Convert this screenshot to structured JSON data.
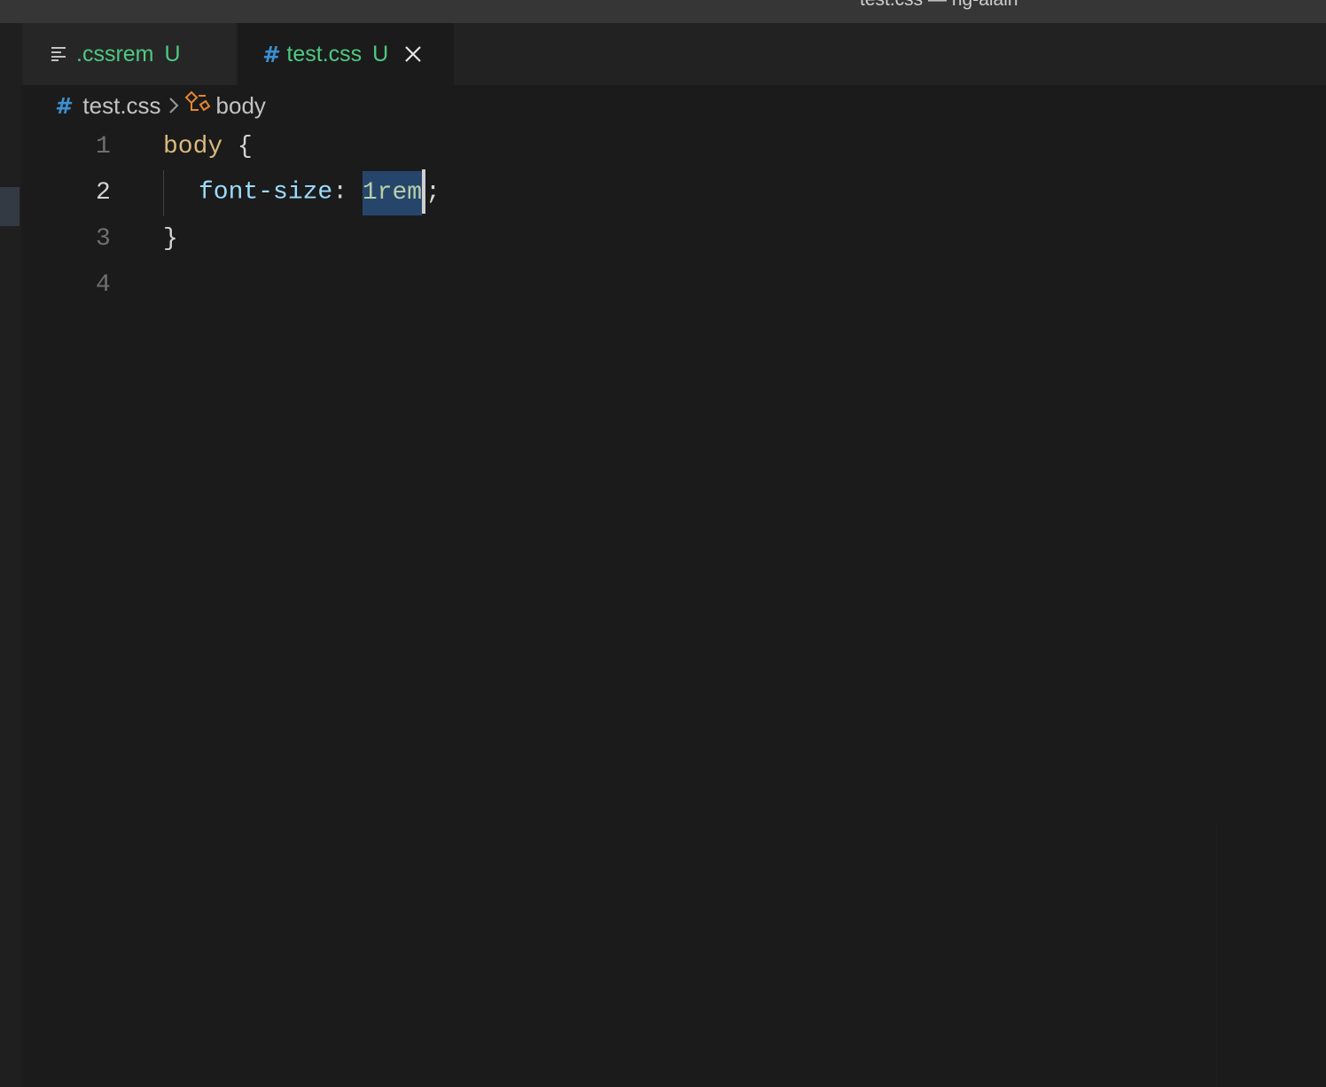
{
  "window": {
    "title": "test.css — ng-alain"
  },
  "tabs": [
    {
      "label": ".cssrem",
      "badge": "U",
      "icon": "list-icon",
      "active": false
    },
    {
      "label": "test.css",
      "badge": "U",
      "icon": "css-hash-icon",
      "active": true,
      "close_icon": "close-icon"
    }
  ],
  "breadcrumb": {
    "file": "test.css",
    "file_icon": "css-hash-icon",
    "separator_icon": "chevron-right-icon",
    "symbol": "body",
    "symbol_icon": "selector-symbol-icon"
  },
  "editor": {
    "line_numbers": [
      "1",
      "2",
      "3",
      "4"
    ],
    "active_line": "2",
    "line1": {
      "selector": "body",
      "brace": " {"
    },
    "line2": {
      "property": "font-size",
      "colon": ": ",
      "value": "1rem",
      "semicolon": ";"
    },
    "line3": {
      "brace": "}"
    }
  },
  "colors": {
    "added_badge": "#4ec982",
    "css_icon": "#3c8fd0",
    "selector": "#d7ba7d",
    "property": "#9cdcfe",
    "value": "#b5cea8",
    "selection": "#26456b"
  }
}
